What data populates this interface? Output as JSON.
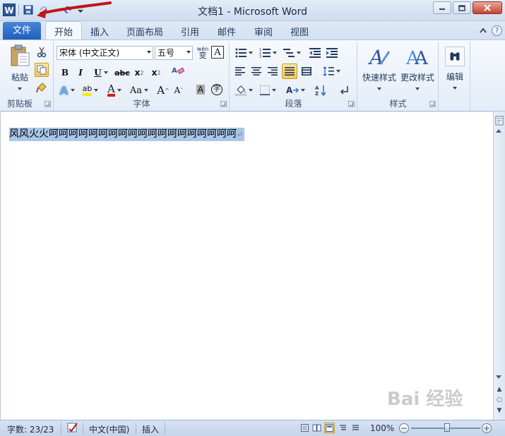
{
  "window": {
    "title": "文档1 - Microsoft Word",
    "app_icon_letter": "W",
    "annotation_color": "#c0161b"
  },
  "quick_access": {
    "save_icon": "save-icon",
    "undo_icon": "undo-icon",
    "redo_icon": "redo-icon",
    "customize_icon": "customize-qat-icon"
  },
  "tabs": {
    "file": "文件",
    "items": [
      "开始",
      "插入",
      "页面布局",
      "引用",
      "邮件",
      "审阅",
      "视图"
    ],
    "active": "开始"
  },
  "ribbon": {
    "clipboard": {
      "label": "剪贴板",
      "paste": "粘贴"
    },
    "font": {
      "label": "字体",
      "font_name": "宋体 (中文正文)",
      "font_size": "五号",
      "phonetic": "wén",
      "border_char": "A",
      "bold": "B",
      "italic": "I",
      "underline": "U",
      "strikethrough": "abc",
      "subscript": "x",
      "subscript_mark": "2",
      "superscript": "x",
      "superscript_mark": "2",
      "clear": "A",
      "text_effects": "A",
      "highlight": "ab",
      "font_color": "A",
      "change_case": "Aa",
      "grow": "A",
      "shrink": "A",
      "shading": "A",
      "enclose": "字"
    },
    "paragraph": {
      "label": "段落"
    },
    "styles": {
      "label": "样式",
      "quick_styles": "快速样式",
      "change_styles": "更改样式"
    },
    "editing": {
      "label": "编辑"
    }
  },
  "document": {
    "text": "风风火火呵呵呵呵呵呵呵呵呵呵呵呵呵呵呵呵呵呵呵",
    "paragraph_mark": "↵",
    "selection_color": "#a9c6e8"
  },
  "statusbar": {
    "word_count": "字数: 23/23",
    "language": "中文(中国)",
    "mode": "插入",
    "zoom": "100%",
    "zoom_out": "−",
    "zoom_in": "+",
    "zoom_level": 1.0
  },
  "watermark": {
    "text": "Bai 经验"
  }
}
